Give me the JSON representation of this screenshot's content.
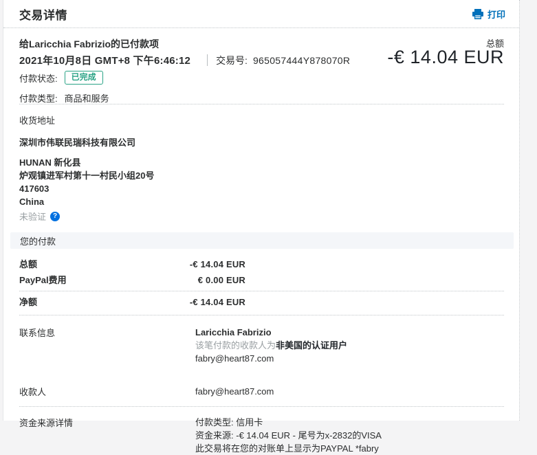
{
  "header": {
    "title": "交易详情",
    "print_label": "打印"
  },
  "summary": {
    "payment_to": "给Laricchia Fabrizio的已付款项",
    "total_label": "总额",
    "date": "2021年10月8日 GMT+8 下午6:46:12",
    "txn_label": "交易号:",
    "txn_id": "965057444Y878070R",
    "amount": "-€ 14.04 EUR",
    "status_label": "付款状态:",
    "status_value": "已完成",
    "type_label": "付款类型:",
    "type_value": "商品和服务"
  },
  "shipping": {
    "title": "收货地址",
    "company": "深圳市伟联民瑞科技有限公司",
    "lines": [
      "HUNAN 新化县",
      "炉观镇进军村第十一村民小组20号",
      "417603",
      "China"
    ],
    "verify_status": "未验证",
    "help_glyph": "?"
  },
  "payment_section": {
    "title": "您的付款",
    "rows": [
      {
        "label": "总额",
        "value": "-€ 14.04 EUR"
      },
      {
        "label": "PayPal费用",
        "value": "€ 0.00 EUR"
      },
      {
        "label": "净额",
        "value": "-€ 14.04 EUR"
      }
    ]
  },
  "contact": {
    "label": "联系信息",
    "name": "Laricchia Fabrizio",
    "note_gray": "该笔付款的收款人为",
    "note_bold": "非美国的认证用户",
    "email": "fabry@heart87.com"
  },
  "payee": {
    "label": "收款人",
    "email": "fabry@heart87.com"
  },
  "funding": {
    "label": "资金来源详情",
    "type_label": "付款类型:",
    "type_value": "信用卡",
    "source_label": "资金来源:",
    "source_value": "-€ 14.04 EUR - 尾号为x-2832的VISA",
    "statement_note": "此交易将在您的对账单上显示为PAYPAL *fabry"
  },
  "colors": {
    "accent_blue": "#0070ba",
    "help_blue": "#0070e0",
    "success_teal": "#29a385",
    "text_dark": "#2c2e2f",
    "text_gray": "#9aa0a3",
    "section_bar_bg": "#f4f6f9",
    "page_bg": "#f4f4f5"
  }
}
